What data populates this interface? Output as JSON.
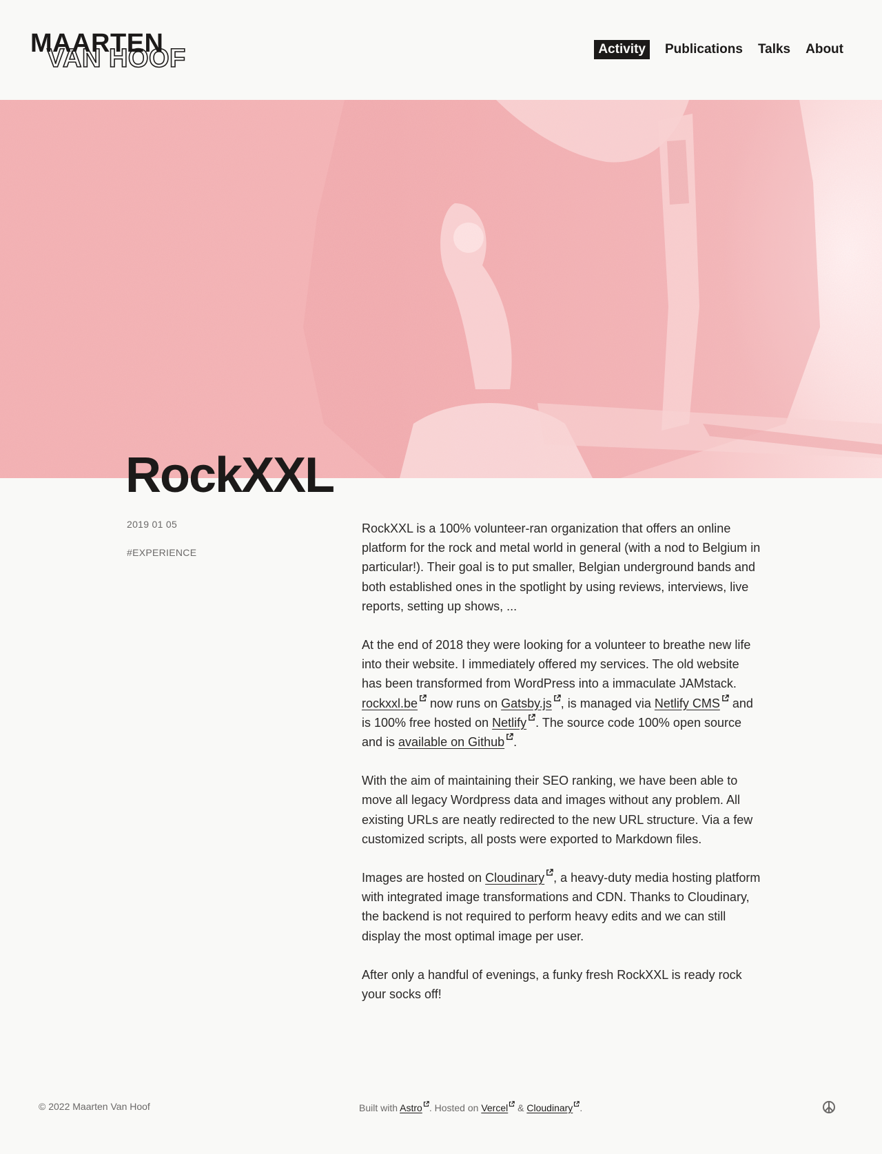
{
  "site": {
    "logo_line1": "MAARTEN",
    "logo_line2": "VAN HOOF"
  },
  "nav": {
    "items": [
      {
        "label": "Activity",
        "active": true
      },
      {
        "label": "Publications",
        "active": false
      },
      {
        "label": "Talks",
        "active": false
      },
      {
        "label": "About",
        "active": false
      }
    ]
  },
  "hero": {
    "image_subject": "guitarist-photo",
    "tint_color": "#f2b2b4"
  },
  "article": {
    "title": "RockXXL",
    "date": "2019 01 05",
    "tag": "#EXPERIENCE",
    "p1": "RockXXL is a 100% volunteer-ran organization that offers an online platform for the rock and metal world in general (with a nod to Belgium in particular!). Their goal is to put smaller, Belgian underground bands and both established ones in the spotlight by using reviews, interviews, live reports, setting up shows, ...",
    "p2": {
      "t1": "At the end of 2018 they were looking for a volunteer to breathe new life into their website. I immediately offered my services. The old website has been transformed from WordPress into a immaculate JAMstack. ",
      "l1": "rockxxl.be",
      "t2": " now runs on ",
      "l2": "Gatsby.js",
      "t3": ", is managed via ",
      "l3": "Netlify CMS",
      "t4": " and is 100% free hosted on ",
      "l4": "Netlify",
      "t5": ". The source code 100% open source and is ",
      "l5": "available on Github",
      "t6": "."
    },
    "p3": "With the aim of maintaining their SEO ranking, we have been able to move all legacy Wordpress data and images without any problem. All existing URLs are neatly redirected to the new URL structure. Via a few customized scripts, all posts were exported to Markdown files.",
    "p4": {
      "t1": "Images are hosted on ",
      "l1": "Cloudinary",
      "t2": ", a heavy-duty media hosting platform with integrated image transformations and CDN. Thanks to Cloudinary, the backend is not required to perform heavy edits and we can still display the most optimal image per user."
    },
    "p5": "After only a handful of evenings, a funky fresh RockXXL is ready rock your socks off!"
  },
  "footer": {
    "copyright": "© 2022 Maarten Van Hoof",
    "built_with": "Built with ",
    "astro": "Astro",
    "hosted_on": ". Hosted on ",
    "vercel": "Vercel",
    "amp": " & ",
    "cloudinary": "Cloudinary",
    "end": ".",
    "peace_icon": "peace-icon"
  }
}
